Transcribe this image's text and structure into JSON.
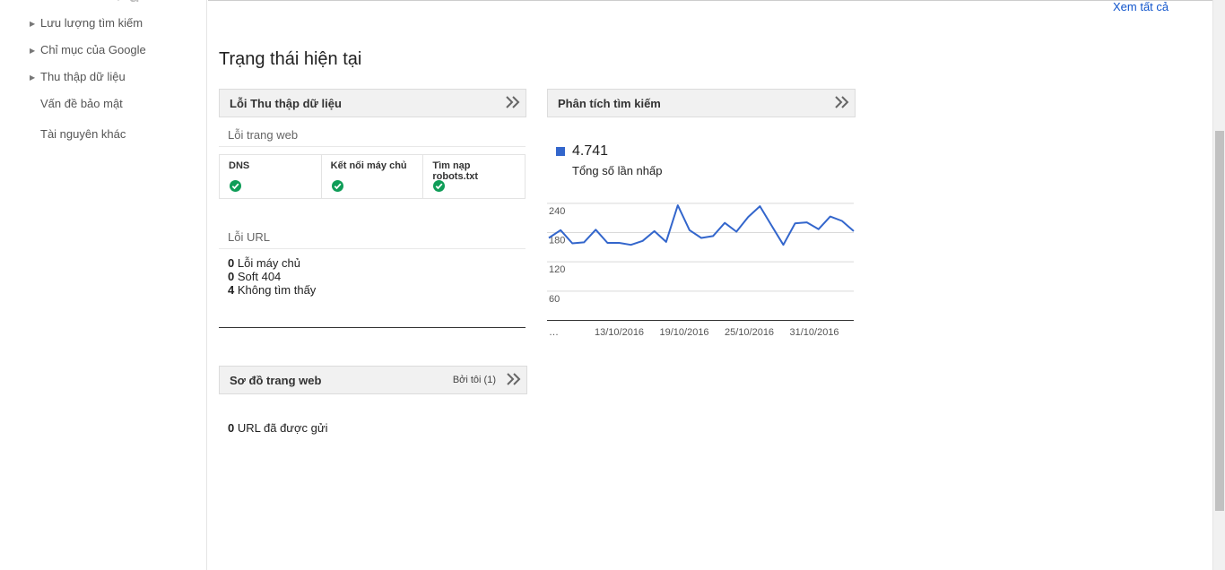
{
  "sidebar": {
    "items": [
      {
        "label": "Lưu lượng tìm kiếm",
        "expandable": true
      },
      {
        "label": "Chỉ mục của Google",
        "expandable": true
      },
      {
        "label": "Thu thập dữ liệu",
        "expandable": true
      },
      {
        "label": "Vấn đề bảo mật",
        "expandable": false
      },
      {
        "label": "Tài nguyên khác",
        "expandable": false
      }
    ]
  },
  "header": {
    "view_all": "Xem tất cả"
  },
  "page_title": "Trạng thái hiện tại",
  "crawl_errors": {
    "title": "Lỗi Thu thập dữ liệu",
    "site_errors_label": "Lỗi trang web",
    "columns": [
      {
        "label": "DNS",
        "status": "ok"
      },
      {
        "label": "Kết nối máy chủ",
        "status": "ok"
      },
      {
        "label": "Tìm nạp robots.txt",
        "status": "ok"
      }
    ],
    "url_errors_label": "Lỗi URL",
    "url_errors": [
      {
        "count": "0",
        "label": "Lỗi máy chủ"
      },
      {
        "count": "0",
        "label": "Soft 404"
      },
      {
        "count": "4",
        "label": "Không tìm thấy"
      }
    ]
  },
  "search_analytics": {
    "title": "Phân tích tìm kiếm",
    "total_value": "4.741",
    "total_label": "Tổng số lần nhấp"
  },
  "sitemaps": {
    "title": "Sơ đồ trang web",
    "by_me": "Bởi tôi (1)",
    "submitted_count": "0",
    "submitted_label": "URL đã được gửi"
  },
  "colors": {
    "accent": "#3366cc",
    "ok": "#0f9d58",
    "link": "#1155cc"
  },
  "chart_data": {
    "type": "line",
    "x": [
      "…",
      "",
      "",
      "",
      "",
      "",
      "13/10/2016",
      "",
      "",
      "",
      "",
      "",
      "19/10/2016",
      "",
      "",
      "",
      "",
      "",
      "25/10/2016",
      "",
      "",
      "",
      "",
      "",
      "31/10/2016",
      "",
      "",
      "",
      ""
    ],
    "x_ticks": [
      "…",
      "13/10/2016",
      "19/10/2016",
      "25/10/2016",
      "31/10/2016"
    ],
    "y_ticks": [
      240,
      180,
      120,
      60
    ],
    "ylim": [
      0,
      270
    ],
    "series": [
      {
        "values": [
          168,
          184,
          157,
          159,
          185,
          158,
          158,
          154,
          162,
          182,
          160,
          235,
          184,
          168,
          172,
          199,
          181,
          211,
          233,
          193,
          154,
          198,
          200,
          186,
          212,
          203,
          182
        ]
      }
    ],
    "grid": true
  }
}
